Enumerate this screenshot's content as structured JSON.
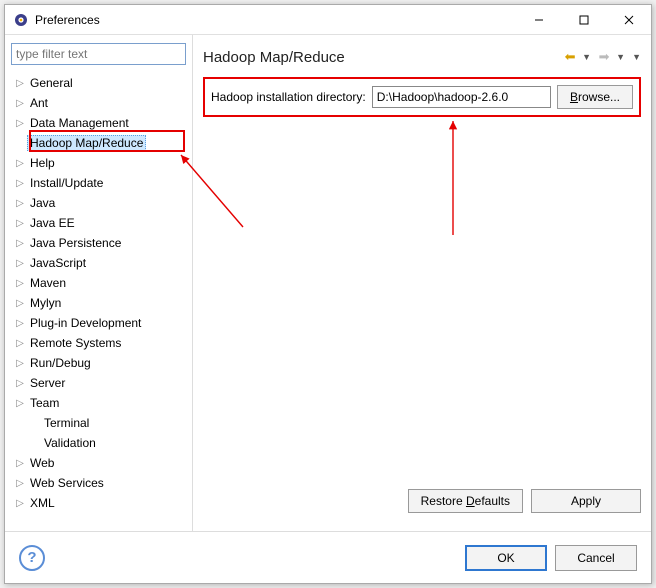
{
  "title": "Preferences",
  "filter_placeholder": "type filter text",
  "tree": [
    {
      "label": "General",
      "exp": true
    },
    {
      "label": "Ant",
      "exp": true
    },
    {
      "label": "Data Management",
      "exp": true
    },
    {
      "label": "Hadoop Map/Reduce",
      "exp": false,
      "selected": true
    },
    {
      "label": "Help",
      "exp": true
    },
    {
      "label": "Install/Update",
      "exp": true
    },
    {
      "label": "Java",
      "exp": true
    },
    {
      "label": "Java EE",
      "exp": true
    },
    {
      "label": "Java Persistence",
      "exp": true
    },
    {
      "label": "JavaScript",
      "exp": true
    },
    {
      "label": "Maven",
      "exp": true
    },
    {
      "label": "Mylyn",
      "exp": true
    },
    {
      "label": "Plug-in Development",
      "exp": true
    },
    {
      "label": "Remote Systems",
      "exp": true
    },
    {
      "label": "Run/Debug",
      "exp": true
    },
    {
      "label": "Server",
      "exp": true
    },
    {
      "label": "Team",
      "exp": true
    },
    {
      "label": "Terminal",
      "exp": false,
      "indent": true
    },
    {
      "label": "Validation",
      "exp": false,
      "indent": true
    },
    {
      "label": "Web",
      "exp": true
    },
    {
      "label": "Web Services",
      "exp": true
    },
    {
      "label": "XML",
      "exp": true
    }
  ],
  "page_heading": "Hadoop Map/Reduce",
  "dir_label": "Hadoop installation directory:",
  "dir_value": "D:\\Hadoop\\hadoop-2.6.0",
  "browse_label": "Browse...",
  "restore_label": "Restore Defaults",
  "apply_label": "Apply",
  "ok_label": "OK",
  "cancel_label": "Cancel"
}
